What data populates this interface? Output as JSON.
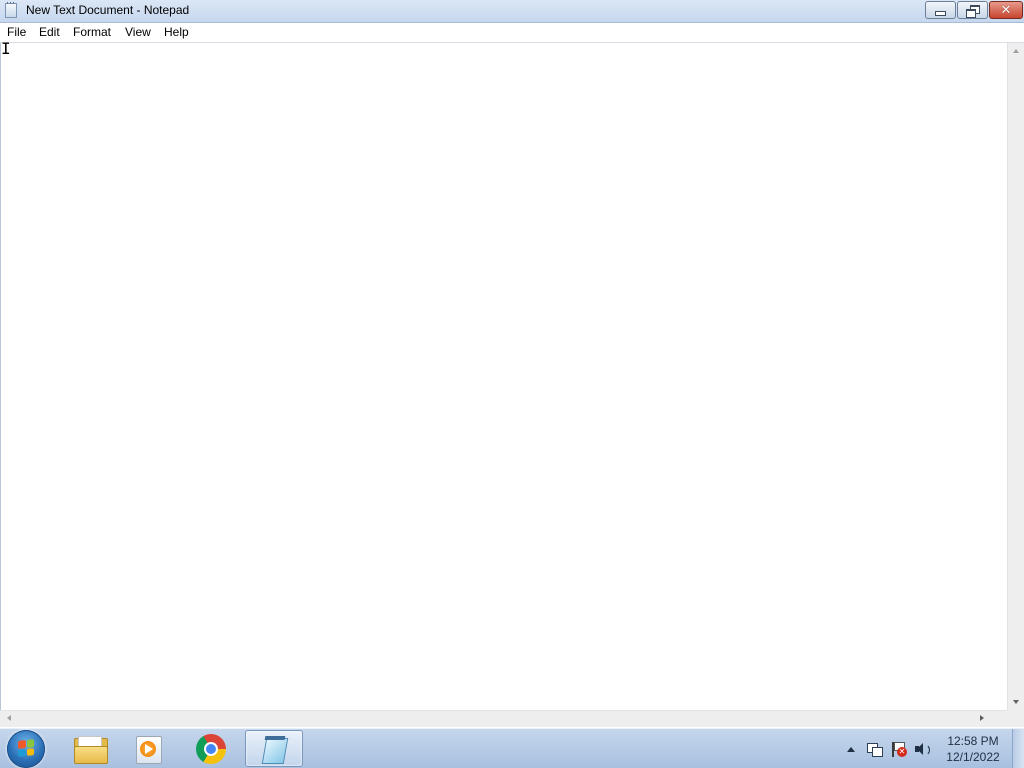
{
  "window": {
    "title": "New Text Document - Notepad"
  },
  "menu": {
    "items": [
      "File",
      "Edit",
      "Format",
      "View",
      "Help"
    ]
  },
  "editor": {
    "content": ""
  },
  "taskbar": {
    "pinned": [
      "windows-explorer",
      "windows-media-player",
      "google-chrome",
      "notepad"
    ],
    "active": "notepad"
  },
  "tray": {
    "time": "12:58 PM",
    "date": "12/1/2022"
  },
  "colors": {
    "titlebar": "#c6d7ee",
    "close_button": "#c8452e",
    "taskbar": "#b7cbe6"
  },
  "icons": {
    "window_icon": "notepad-icon",
    "tray": [
      "show-hidden-icons-arrow",
      "network-icon",
      "action-center-flag-icon",
      "volume-icon"
    ]
  }
}
